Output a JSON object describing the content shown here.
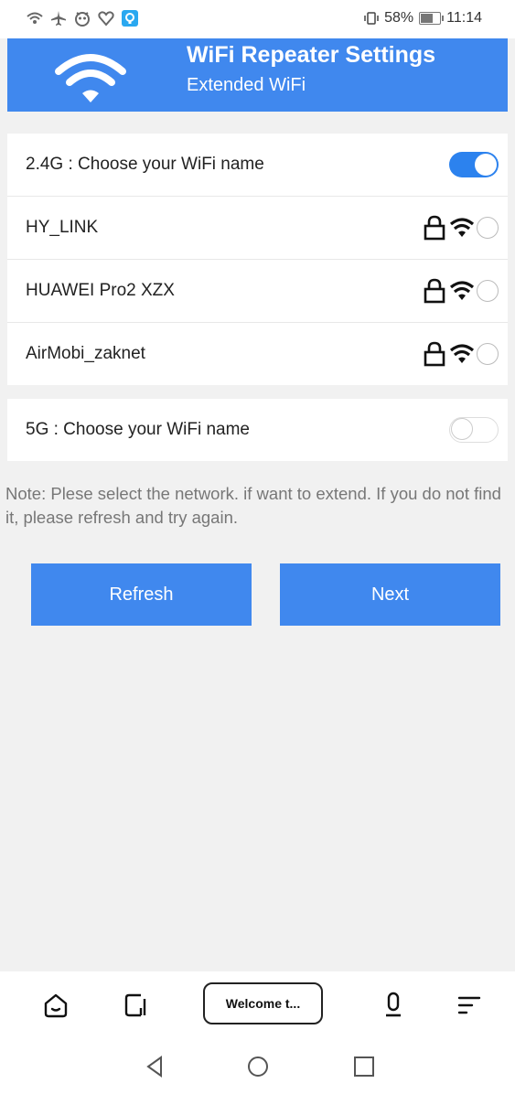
{
  "status_bar": {
    "left_icons": [
      "wifi-calling-icon",
      "airplane-icon",
      "eye-icon",
      "heart-icon",
      "app-notification-icon"
    ],
    "battery_percent": "58%",
    "battery_level": 0.58,
    "time": "11:14"
  },
  "header": {
    "title": "WiFi Repeater Settings",
    "subtitle": "Extended WiFi",
    "color": "#4088ee"
  },
  "band_24": {
    "label": "2.4G : Choose your WiFi name",
    "enabled": true
  },
  "networks": [
    {
      "name": "HY_LINK"
    },
    {
      "name": "HUAWEI Pro2 XZX"
    },
    {
      "name": "AirMobi_zaknet"
    }
  ],
  "band_5": {
    "label": "5G : Choose your WiFi name",
    "enabled": false
  },
  "note": "Note: Plese select the network. if want to extend. If you do not find it, please refresh and try again.",
  "buttons": {
    "refresh": "Refresh",
    "next": "Next"
  },
  "browser_toolbar": {
    "tab_label": "Welcome t..."
  }
}
